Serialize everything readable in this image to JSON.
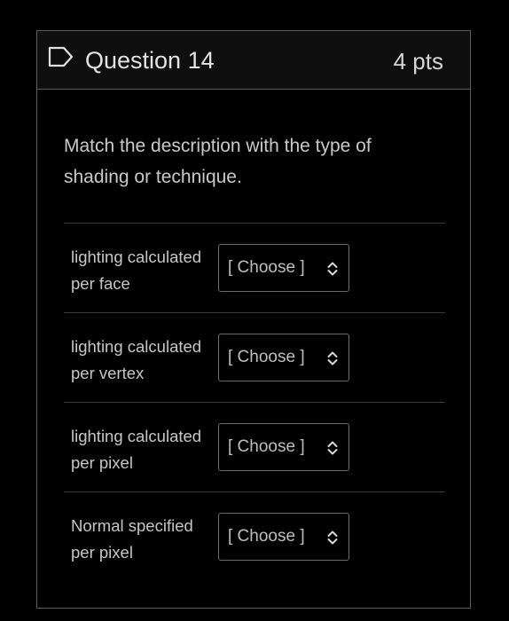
{
  "header": {
    "title": "Question 14",
    "points": "4 pts"
  },
  "prompt": "Match the description with the type of shading or technique.",
  "rows": [
    {
      "label": "lighting calculated per face",
      "select_value": "[ Choose ]"
    },
    {
      "label": "lighting calculated per vertex",
      "select_value": "[ Choose ]"
    },
    {
      "label": "lighting calculated per pixel",
      "select_value": "[ Choose ]"
    },
    {
      "label": "Normal specified per pixel",
      "select_value": "[ Choose ]"
    }
  ],
  "icons": {
    "flag": "bookmark-flag-icon",
    "select_arrow": "up-down-chevron-icon"
  },
  "colors": {
    "background": "#000000",
    "header_bg": "#0f0f0f",
    "border": "#5a5a5a",
    "text": "#c9c9c9"
  }
}
